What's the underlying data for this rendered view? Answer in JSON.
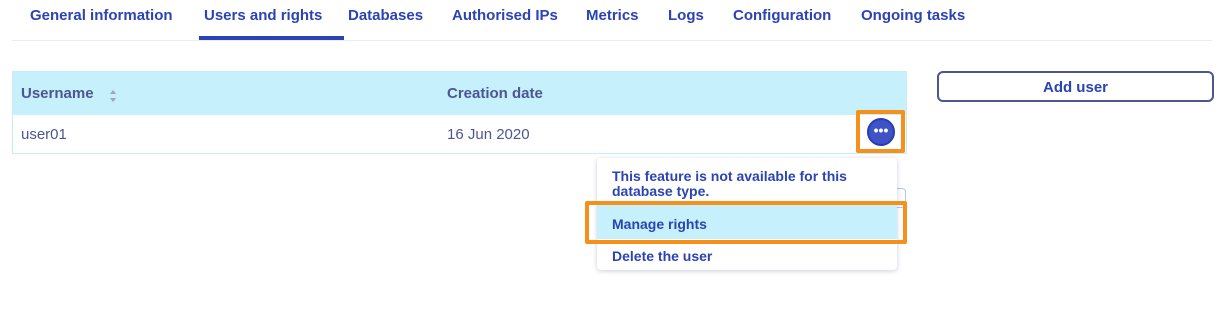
{
  "tabs": [
    {
      "label": "General information"
    },
    {
      "label": "Users and rights",
      "active": true
    },
    {
      "label": "Databases"
    },
    {
      "label": "Authorised IPs"
    },
    {
      "label": "Metrics"
    },
    {
      "label": "Logs"
    },
    {
      "label": "Configuration"
    },
    {
      "label": "Ongoing tasks"
    }
  ],
  "table": {
    "headers": {
      "username": "Username",
      "creation_date": "Creation date"
    },
    "rows": [
      {
        "username": "user01",
        "creation_date": "16 Jun 2020"
      }
    ],
    "actions_icon": "more-horizontal-icon"
  },
  "add_user": {
    "label": "Add user"
  },
  "menu": {
    "note": "This feature is not available for this database type.",
    "items": [
      {
        "label": "Manage rights",
        "highlighted": true
      },
      {
        "label": "Delete the user"
      }
    ]
  },
  "colors": {
    "primary": "#2b43b3",
    "text": "#4d5592",
    "header_bg": "#c6f0fb",
    "highlight_frame": "#f5901a",
    "action_button": "#3d53c6"
  }
}
